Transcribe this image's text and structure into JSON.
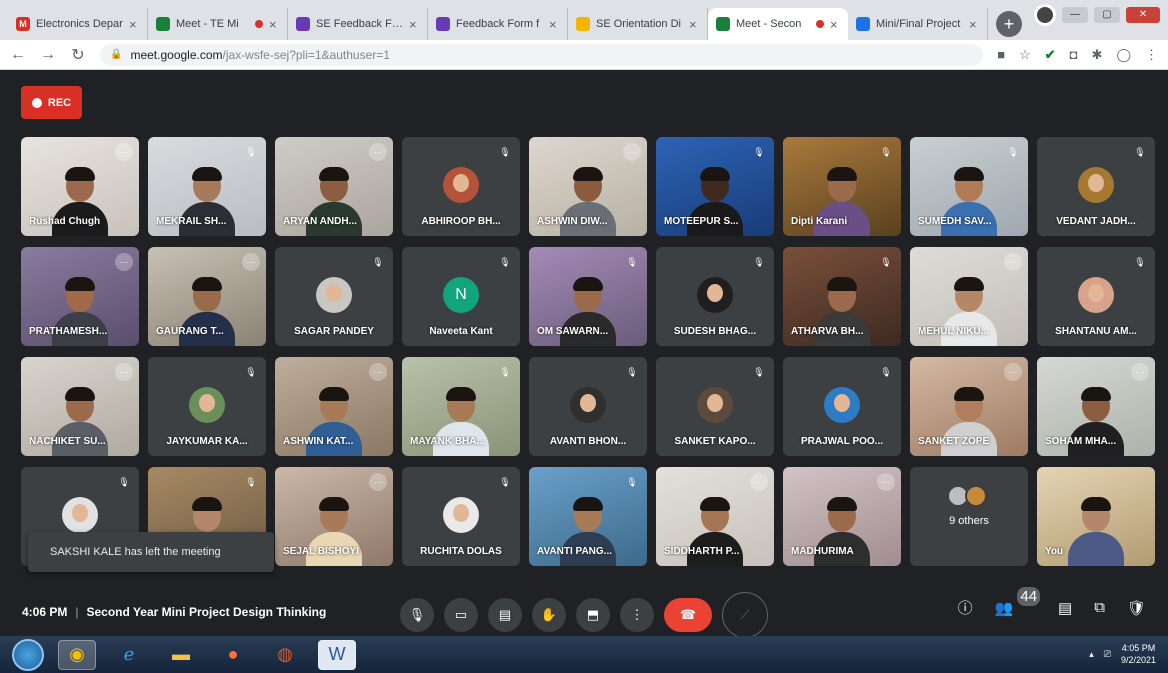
{
  "browser": {
    "tabs": [
      {
        "title": "Electronics Depar",
        "fav_color": "#d93025",
        "fav_letter": "M"
      },
      {
        "title": "Meet - TE Mi",
        "fav_color": "#188038",
        "fav_letter": "",
        "recording": true
      },
      {
        "title": "SE Feedback Form",
        "fav_color": "#673ab7",
        "fav_letter": ""
      },
      {
        "title": "Feedback Form f",
        "fav_color": "#673ab7",
        "fav_letter": ""
      },
      {
        "title": "SE Orientation Di",
        "fav_color": "#f4b400",
        "fav_letter": ""
      },
      {
        "title": "Meet - Secon",
        "fav_color": "#188038",
        "fav_letter": "",
        "recording": true,
        "active": true
      },
      {
        "title": "Mini/Final Project",
        "fav_color": "#1a73e8",
        "fav_letter": ""
      }
    ],
    "url_host": "meet.google.com",
    "url_path": "/jax-wsfe-sej?pli=1&authuser=1"
  },
  "rec_label": "REC",
  "participants": [
    {
      "name": "Rushad Chugh",
      "type": "video",
      "c1": "#e7e3df",
      "c2": "#c9c2bb",
      "skin": "#9b6a4c",
      "shirt": "#1b1b1b",
      "mic": "dim"
    },
    {
      "name": "MEKRAIL SH...",
      "type": "video",
      "c1": "#d9dbdf",
      "c2": "#b9bcc2",
      "skin": "#a67a5a",
      "shirt": "#2d2d35",
      "mic": "muted"
    },
    {
      "name": "ARYAN ANDH...",
      "type": "video",
      "c1": "#cfccc6",
      "c2": "#aaa59d",
      "skin": "#8c5e41",
      "shirt": "#2b3a2e",
      "mic": "dim"
    },
    {
      "name": "ABHIROOP BH...",
      "type": "avatar",
      "av": "#b5533a",
      "mic": "muted"
    },
    {
      "name": "ASHWIN DIW...",
      "type": "video",
      "c1": "#dcd7cf",
      "c2": "#b8b0a2",
      "skin": "#8c5a3c",
      "shirt": "#6a6f75",
      "mic": "dim"
    },
    {
      "name": "MOTEEPUR S...",
      "type": "video",
      "c1": "#2d63b5",
      "c2": "#183c77",
      "skin": "#3f2a20",
      "shirt": "#1a1a1a",
      "mic": "muted"
    },
    {
      "name": "Dipti Karani",
      "type": "video",
      "c1": "#a97a3b",
      "c2": "#5a4020",
      "skin": "#9b6a4c",
      "shirt": "#6a4e86",
      "mic": "muted"
    },
    {
      "name": "SUMEDH SAV...",
      "type": "video",
      "c1": "#c9cfd3",
      "c2": "#9ea8ae",
      "skin": "#b07a57",
      "shirt": "#3a6fb0",
      "mic": "muted"
    },
    {
      "name": "VEDANT JADH...",
      "type": "avatar",
      "av": "#a5792f",
      "mic": "muted"
    },
    {
      "name": "PRATHAMESH...",
      "type": "video",
      "c1": "#8a7b9f",
      "c2": "#5b4e6c",
      "skin": "#a06a4a",
      "shirt": "#3c3f48",
      "mic": "dim"
    },
    {
      "name": "GAURANG T...",
      "type": "video",
      "c1": "#c7c0b4",
      "c2": "#8b8273",
      "skin": "#9a6b4b",
      "shirt": "#24304a",
      "mic": "dim"
    },
    {
      "name": "SAGAR PANDEY",
      "type": "avatar",
      "av": "#c9c7c2",
      "mic": "muted"
    },
    {
      "name": "Naveeta Kant",
      "type": "letter",
      "av": "#12a47d",
      "letter": "N",
      "mic": "muted"
    },
    {
      "name": "OM SAWARN...",
      "type": "video",
      "c1": "#a38bb6",
      "c2": "#6b5c7a",
      "skin": "#9b6a4c",
      "shirt": "#2a2a2a",
      "mic": "muted"
    },
    {
      "name": "SUDESH BHAG...",
      "type": "avatar",
      "av": "#1f1f1f",
      "mic": "muted"
    },
    {
      "name": "ATHARVA BH...",
      "type": "video",
      "c1": "#7a4f3a",
      "c2": "#3d2a22",
      "skin": "#9b6a4c",
      "shirt": "#3a3a3a",
      "mic": "muted"
    },
    {
      "name": "MEHUL NIKU...",
      "type": "video",
      "c1": "#dfdcd8",
      "c2": "#c2bdb6",
      "skin": "#b58767",
      "shirt": "#e8e8e8",
      "mic": "dim"
    },
    {
      "name": "SHANTANU AM...",
      "type": "avatar",
      "av": "#d9a38b",
      "mic": "muted"
    },
    {
      "name": "NACHIKET SU...",
      "type": "video",
      "c1": "#d8d4ce",
      "c2": "#b0a99f",
      "skin": "#9b6a4c",
      "shirt": "#5a5f66",
      "mic": "dim"
    },
    {
      "name": "JAYKUMAR KA...",
      "type": "avatar",
      "av": "#6b8f5a",
      "mic": "muted"
    },
    {
      "name": "ASHWIN KAT...",
      "type": "video",
      "c1": "#bfae9b",
      "c2": "#8a7865",
      "skin": "#a97a58",
      "shirt": "#2f5f95",
      "mic": "dim"
    },
    {
      "name": "MAYANK BHA...",
      "type": "video",
      "c1": "#b9c2a9",
      "c2": "#8a9277",
      "skin": "#a87a57",
      "shirt": "#dfe5ec",
      "mic": "muted"
    },
    {
      "name": "AVANTI BHON...",
      "type": "avatar",
      "av": "#2f2f2f",
      "mic": "muted"
    },
    {
      "name": "SANKET KAPO...",
      "type": "avatar",
      "av": "#5c4a3d",
      "mic": "muted"
    },
    {
      "name": "PRAJWAL POO...",
      "type": "avatar",
      "av": "#2e7bc7",
      "mic": "muted"
    },
    {
      "name": "SANKET ZOPE",
      "type": "video",
      "c1": "#d4b9a4",
      "c2": "#9e7b62",
      "skin": "#b07e5c",
      "shirt": "#cfcfcf",
      "mic": "dim"
    },
    {
      "name": "SOHAM MHA...",
      "type": "video",
      "c1": "#d6d8d3",
      "c2": "#aeb2aa",
      "skin": "#8c5e41",
      "shirt": "#202020",
      "mic": "dim"
    },
    {
      "name": "",
      "type": "avatar",
      "av": "#e1e1e1",
      "mic": "muted"
    },
    {
      "name": "",
      "type": "video",
      "c1": "#a78a64",
      "c2": "#6d5a43",
      "skin": "#b5876a",
      "shirt": "#3b3b3b",
      "mic": "muted"
    },
    {
      "name": "SEJAL BISHOYI",
      "type": "video",
      "c1": "#cbb8a7",
      "c2": "#8e786a",
      "skin": "#a97a58",
      "shirt": "#e9d6b4",
      "mic": "dim"
    },
    {
      "name": "RUCHITA DOLAS",
      "type": "avatar",
      "av": "#e9e9e9",
      "mic": "muted"
    },
    {
      "name": "AVANTI PANG...",
      "type": "video",
      "c1": "#6aa0c9",
      "c2": "#3c6a8a",
      "skin": "#a97a58",
      "shirt": "#2d3e52",
      "mic": "muted"
    },
    {
      "name": "SIDDHARTH P...",
      "type": "video",
      "c1": "#e3e0dc",
      "c2": "#c7c1b9",
      "skin": "#a57554",
      "shirt": "#1d1d1d",
      "mic": "dim"
    },
    {
      "name": "MADHURIMA",
      "type": "video",
      "c1": "#d2c3c4",
      "c2": "#a18d8f",
      "skin": "#9b6a4c",
      "shirt": "#2e2e2e",
      "mic": "dim"
    },
    {
      "name": "9 others",
      "type": "others",
      "mic": ""
    },
    {
      "name": "You",
      "type": "video",
      "c1": "#e4d4b4",
      "c2": "#b29b72",
      "skin": "#b5876a",
      "shirt": "#4b5a85",
      "mic": ""
    }
  ],
  "toast": "SAKSHI KALE has left the meeting",
  "meeting": {
    "time": "4:06 PM",
    "separator": "|",
    "title": "Second Year Mini Project Design Thinking"
  },
  "people_count": "44",
  "taskbar": {
    "time": "4:05 PM",
    "date": "9/2/2021"
  }
}
